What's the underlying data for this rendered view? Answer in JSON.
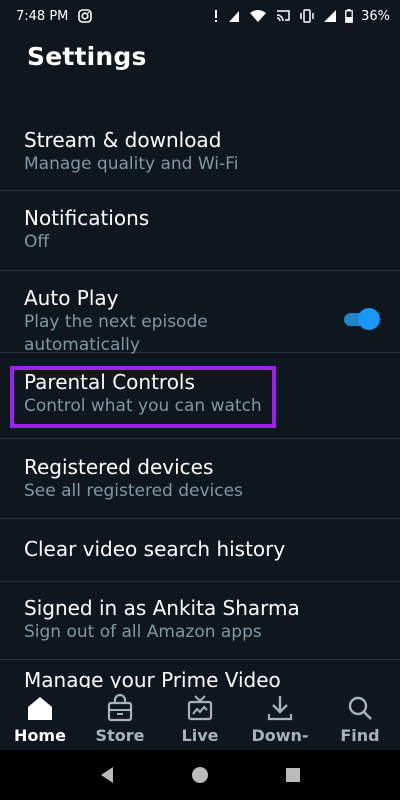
{
  "status_bar": {
    "time": "7:48 PM",
    "battery": "36%",
    "icons": [
      "instagram-icon",
      "notification-icon",
      "signal-icon",
      "wifi-icon",
      "cast-icon",
      "vibrate-icon",
      "cellular-icon",
      "battery-icon"
    ]
  },
  "header": {
    "title": "Settings"
  },
  "settings": [
    {
      "title": "Stream & download",
      "subtitle": "Manage quality and Wi-Fi"
    },
    {
      "title": "Notifications",
      "subtitle": "Off"
    },
    {
      "title": "Auto Play",
      "subtitle": "Play the next episode automatically",
      "toggle_on": true
    },
    {
      "title": "Parental Controls",
      "subtitle": "Control what you can watch",
      "highlighted": true
    },
    {
      "title": "Registered devices",
      "subtitle": "See all registered devices"
    },
    {
      "title": "Clear video search history"
    },
    {
      "title": "Signed in as Ankita Sharma",
      "subtitle": "Sign out of all Amazon apps"
    },
    {
      "title": "Manage your Prime Video"
    }
  ],
  "bottom_nav": [
    {
      "label": "Home",
      "icon": "home-icon",
      "active": true
    },
    {
      "label": "Store",
      "icon": "store-icon",
      "active": false
    },
    {
      "label": "Live",
      "icon": "live-tv-icon",
      "active": false
    },
    {
      "label": "Down-",
      "icon": "download-icon",
      "active": false
    },
    {
      "label": "Find",
      "icon": "search-icon",
      "active": false
    }
  ],
  "system_nav": [
    "back-icon",
    "home-circle-icon",
    "recents-icon"
  ],
  "colors": {
    "background": "#0f171e",
    "subtitle": "#8197a4",
    "toggle": "#1a98ff",
    "highlight": "#a020f0"
  }
}
